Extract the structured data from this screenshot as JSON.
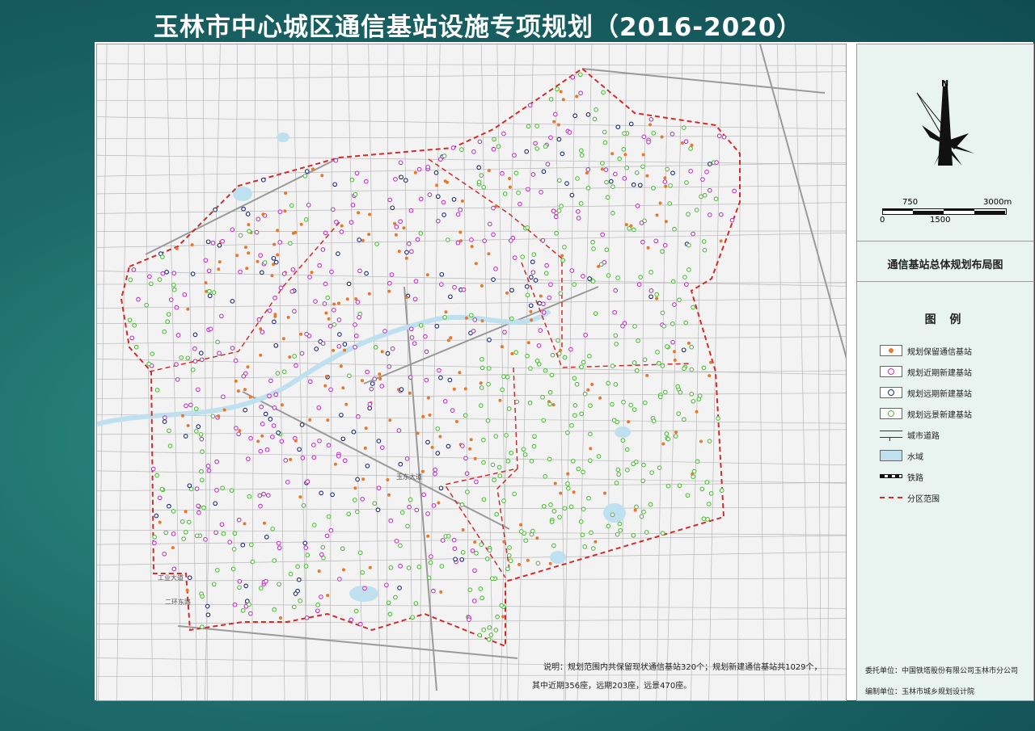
{
  "title": "玉林市中心城区通信基站设施专项规划（2016-2020）",
  "map": {
    "note_line1": "说明：规划范围内共保留现状通信基站320个；规划新建通信基站共1029个，",
    "note_line2": "其中近期356座，远期203座，远景470座。",
    "street_labels": [
      "工业大道",
      "二环东路",
      "玉东大道"
    ],
    "colors": {
      "retain": "#e8782c",
      "near": "#c233c8",
      "far": "#1d2a7a",
      "long": "#4fbf3a",
      "boundary": "#d42a2a",
      "water": "#bfe0ee",
      "road": "#b8b8b8"
    }
  },
  "panel": {
    "north": "N",
    "scale_top": [
      "750",
      "3000m"
    ],
    "scale_bottom": [
      "0",
      "1500"
    ],
    "map_title": "通信基站总体规划布局图",
    "legend_heading": "图 例",
    "legend": [
      {
        "label": "规划保留通信基站",
        "symbol": "retain-dot"
      },
      {
        "label": "规划近期新建基站",
        "symbol": "near-circle"
      },
      {
        "label": "规划远期新建基站",
        "symbol": "far-circle"
      },
      {
        "label": "规划远景新建基站",
        "symbol": "long-circle"
      },
      {
        "label": "城市道路",
        "symbol": "road-line"
      },
      {
        "label": "水域",
        "symbol": "water-fill"
      },
      {
        "label": "铁路",
        "symbol": "railway-line"
      },
      {
        "label": "分区范围",
        "symbol": "boundary-dash"
      }
    ],
    "commissioned_by": "委托单位：中国铁塔股份有限公司玉林市分公司",
    "prepared_by": "编制单位：玉林市城乡规划设计院"
  }
}
